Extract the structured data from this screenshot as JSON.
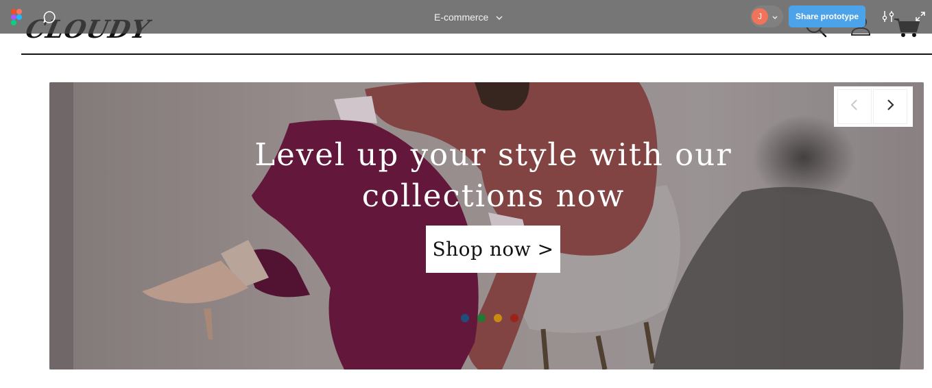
{
  "site": {
    "logo": "CLOUDY"
  },
  "figma": {
    "title": "E-commerce",
    "avatar_initial": "J",
    "share_label": "Share prototype",
    "share_color": "#4ca3e9",
    "avatar_color": "#f0735a"
  },
  "hero": {
    "headline": "Level up your style with our collections now",
    "cta_label": "Shop now >",
    "dots": [
      {
        "color": "#1f4e7a",
        "active": true
      },
      {
        "color": "#1e7a35",
        "active": false
      },
      {
        "color": "#c98a10",
        "active": false
      },
      {
        "color": "#9a2418",
        "active": false
      }
    ]
  },
  "icons": {
    "header": [
      "search-icon",
      "user-icon",
      "cart-icon"
    ],
    "figma_bar": [
      "figma-logo",
      "comment-icon",
      "chevron-down-icon",
      "settings-icon",
      "expand-icon"
    ],
    "slider": [
      "chevron-left-icon",
      "chevron-right-icon"
    ]
  }
}
